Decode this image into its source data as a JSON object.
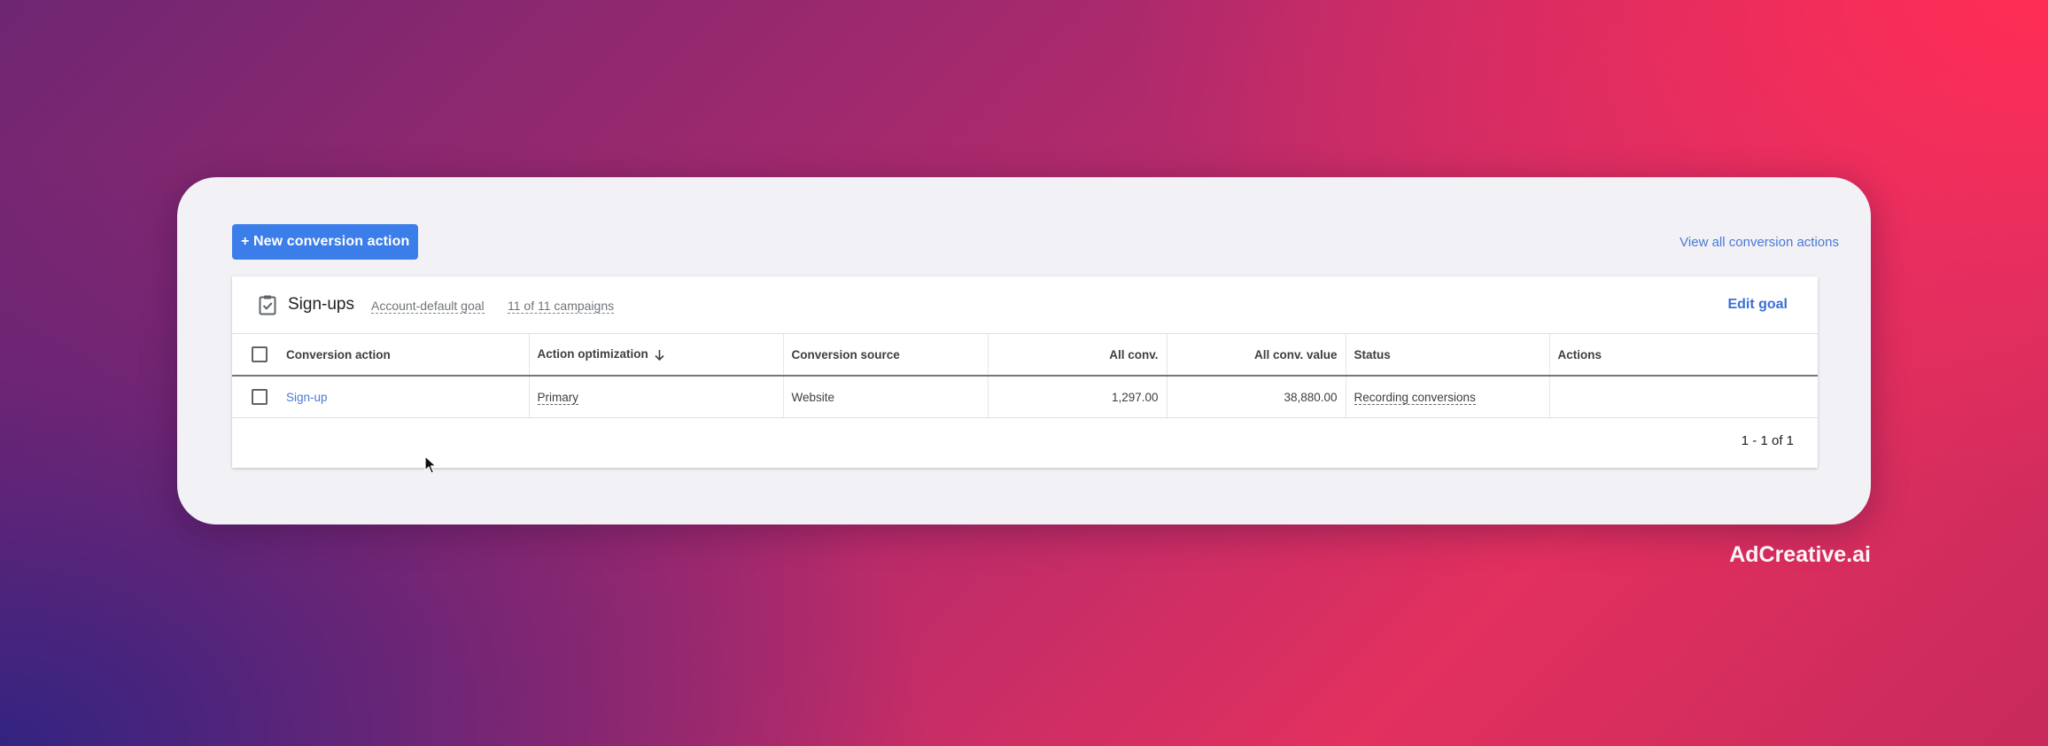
{
  "toolbar": {
    "new_conversion_action": "+ New conversion action",
    "view_all": "View all conversion actions"
  },
  "goal": {
    "icon": "clipboard-check-icon",
    "title": "Sign-ups",
    "default_goal": "Account-default goal",
    "campaigns": "11 of 11 campaigns",
    "edit": "Edit goal"
  },
  "table": {
    "columns": {
      "action": "Conversion action",
      "optimization": "Action optimization",
      "source": "Conversion source",
      "all_conv": "All conv.",
      "all_conv_value": "All conv. value",
      "status": "Status",
      "actions": "Actions"
    },
    "sort_icon": "arrow-down-icon",
    "rows": [
      {
        "action": "Sign-up",
        "optimization": "Primary",
        "source": "Website",
        "all_conv": "1,297.00",
        "all_conv_value": "38,880.00",
        "status": "Recording conversions",
        "actions": ""
      }
    ]
  },
  "pagination": "1 - 1 of 1",
  "brand": "AdCreative.ai",
  "colors": {
    "primary_button": "#3b7de9",
    "link": "#4a7ad6",
    "card_background": "#f2f1f6"
  }
}
